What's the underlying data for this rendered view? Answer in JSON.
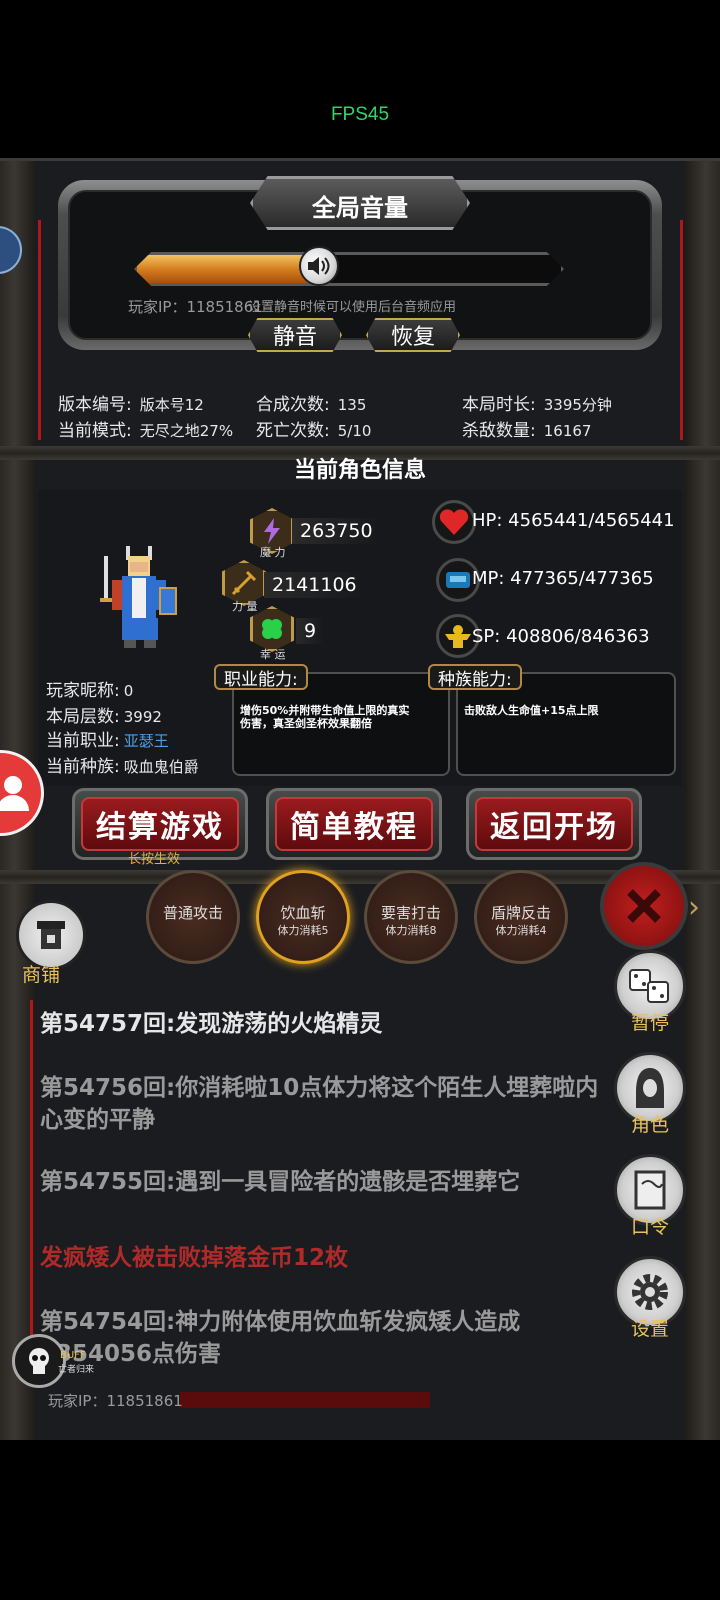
{
  "fps": "FPS45",
  "volume": {
    "title": "全局音量",
    "level": 0.43,
    "player_ip": "玩家IP：11851861",
    "hint": "设置静音时候可以使用后台音频应用",
    "mute_label": "静音",
    "restore_label": "恢复"
  },
  "stats": {
    "version_label": "版本编号:",
    "version_value": "版本号12",
    "mode_label": "当前模式:",
    "mode_value": "无尽之地27%",
    "synth_label": "合成次数:",
    "synth_value": "135",
    "death_label": "死亡次数:",
    "death_value": "5/10",
    "time_label": "本局时长:",
    "time_value": "3395分钟",
    "kills_label": "杀敌数量:",
    "kills_value": "16167"
  },
  "char_section_title": "当前角色信息",
  "attributes": {
    "magic_value": "263750",
    "magic_caption": "魔 力",
    "strength_value": "2141106",
    "strength_caption": "力 量",
    "luck_value": "9",
    "luck_caption": "幸 运"
  },
  "resources": {
    "hp": "HP:  4565441/4565441",
    "mp": "MP:  477365/477365",
    "sp": "SP:  408806/846363"
  },
  "player": {
    "nick_label": "玩家昵称:",
    "nick_value": "0",
    "floors_label": "本局层数:",
    "floors_value": "3992",
    "job_label": "当前职业:",
    "job_value": "亚瑟王",
    "race_label": "当前种族:",
    "race_value": "吸血鬼伯爵"
  },
  "abilities": {
    "job_tag": "职业能力:",
    "job_text_1": "增伤50%并附带生命值上限的真实",
    "job_text_2": "伤害，真圣剑圣杯效果翻倍",
    "race_tag": "种族能力:",
    "race_text": "击败敌人生命值+15点上限"
  },
  "buttons": {
    "settle": "结算游戏",
    "settle_hint": "长按生效",
    "tutorial": "简单教程",
    "back": "返回开场"
  },
  "skills": [
    {
      "name": "普通攻击",
      "cost": ""
    },
    {
      "name": "饮血斩",
      "cost": "体力消耗5"
    },
    {
      "name": "要害打击",
      "cost": "体力消耗8"
    },
    {
      "name": "盾牌反击",
      "cost": "体力消耗4"
    }
  ],
  "shop_label": "商铺",
  "side_menu": {
    "pause": "暂停",
    "role": "角色",
    "code": "口令",
    "settings": "设置"
  },
  "log": [
    {
      "text": "第54757回:发现游荡的火焰精灵",
      "color": "#e6e6e6"
    },
    {
      "text": "第54756回:你消耗啦10点体力将这个陌生人埋葬啦内心变的平静",
      "color": "#9a9a9a"
    },
    {
      "text": "第54755回:遇到一具冒险者的遗骸是否埋葬它",
      "color": "#9a9a9a"
    },
    {
      "text": "发疯矮人被击败掉落金币12枚",
      "color": "#b02a2a"
    },
    {
      "text": "第54754回:神力附体使用饮血斩发疯矮人造成1354056点伤害",
      "color": "#9a9a9a"
    }
  ],
  "buff": {
    "label": "BUFF",
    "sub": "亡者归来"
  },
  "bottom_ip": "玩家IP：11851861"
}
